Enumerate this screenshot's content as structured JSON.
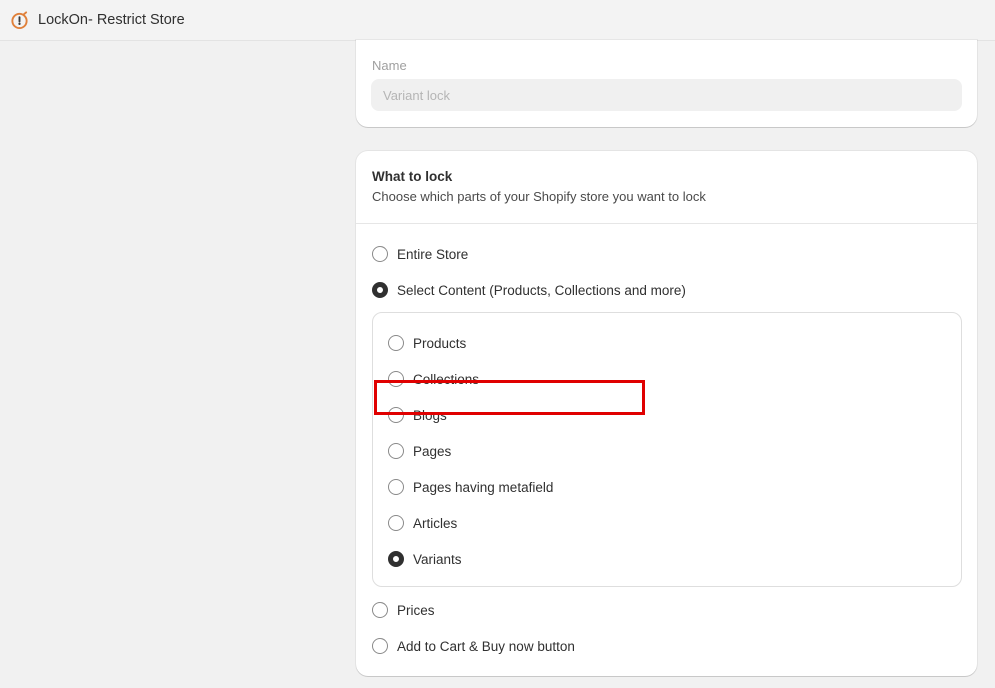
{
  "app": {
    "title": "LockOn- Restrict Store",
    "logo_icon": "lock-clock-icon",
    "accent": "#e0803a"
  },
  "name_section": {
    "label": "Name",
    "value": "Variant lock"
  },
  "lock_section": {
    "title": "What to lock",
    "subtitle": "Choose which parts of your Shopify store you want to lock",
    "options": [
      {
        "label": "Entire Store",
        "checked": false
      },
      {
        "label": "Select Content (Products, Collections and more)",
        "checked": true
      }
    ],
    "content_options": [
      {
        "label": "Products",
        "checked": false
      },
      {
        "label": "Collections",
        "checked": false
      },
      {
        "label": "Blogs",
        "checked": false
      },
      {
        "label": "Pages",
        "checked": false
      },
      {
        "label": "Pages having metafield",
        "checked": false
      },
      {
        "label": "Articles",
        "checked": false
      },
      {
        "label": "Variants",
        "checked": true
      }
    ],
    "more_options": [
      {
        "label": "Prices",
        "checked": false
      },
      {
        "label": "Add to Cart & Buy now button",
        "checked": false
      }
    ],
    "highlight_color": "#e00000"
  }
}
